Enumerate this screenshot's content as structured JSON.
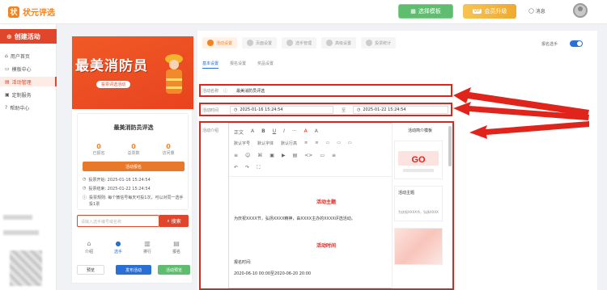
{
  "header": {
    "logo_text": "状元评选",
    "template_btn": "选择模板",
    "vip_badge": "VIP",
    "vip_btn": "会员升级",
    "msg_label": "消息",
    "accent": "#f5821f"
  },
  "sidebar": {
    "create_btn": "创建活动",
    "items": [
      {
        "label": "用户首页",
        "icon": "home-icon"
      },
      {
        "label": "模板中心",
        "icon": "folder-icon"
      },
      {
        "label": "活动管理",
        "icon": "list-icon",
        "active": true
      },
      {
        "label": "定制服务",
        "icon": "service-icon"
      },
      {
        "label": "帮助中心",
        "icon": "help-icon"
      }
    ]
  },
  "preview": {
    "poster_title": "最美消防员",
    "poster_pill": "投票评选活动",
    "card_title": "最美消防员评选",
    "stats": [
      {
        "n": "0",
        "l": "已报名"
      },
      {
        "n": "0",
        "l": "总票数"
      },
      {
        "n": "0",
        "l": "访问量"
      }
    ],
    "apply_btn": "活动报名",
    "info": [
      "投票开始: 2025-01-16 15:24:54",
      "投票结束: 2025-01-22 15:24:54",
      "投票规则: 每个微信号每天可投1次，可以对同一选手投1票"
    ],
    "search_placeholder": "请输入选手编号或名称",
    "search_btn": "搜索",
    "nav": [
      "介绍",
      "选手",
      "排行",
      "报名"
    ],
    "btn_preview": "预览",
    "btn_publish": "发布活动",
    "btn_publish_preview": "活动预览"
  },
  "main": {
    "steps": [
      "活动设置",
      "页面设置",
      "选手管理",
      "高级设置",
      "投票统计"
    ],
    "toggle_label": "报名选手",
    "subtabs": [
      "基本设置",
      "报名设置",
      "奖品设置"
    ],
    "name_label": "活动名称",
    "name_value": "最美消防员评选",
    "time_label": "活动时间",
    "time_start": "2025-01-16 15:24:54",
    "time_sep": "至",
    "time_end": "2025-01-22 15:24:54",
    "intro_label": "活动介绍",
    "toolbar_row1": [
      "正文",
      "A",
      "B",
      "U",
      "I",
      "···",
      "A",
      "A"
    ],
    "toolbar_row2": [
      "默认字号",
      "默认字体",
      "默认行高",
      "≡",
      "≡",
      "▭",
      "▭",
      "▭"
    ],
    "toolbar_row3": [
      "≡",
      "☺",
      "⌘",
      "▣",
      "▶",
      "▤",
      "<>",
      "▭",
      "≡"
    ],
    "toolbar_row4": [
      "↶",
      "↷",
      "⛶"
    ],
    "editor": {
      "h1": "活动主题",
      "p1": "为庆祝XXXX节，弘扬XXXX精神，由XXXX主办的XXXX评选活动。",
      "h2": "活动时间",
      "p2": "报名时间:",
      "p3": "2020-06-10 00:00至2020-06-20 20:00"
    },
    "template_panel": {
      "title": "活动简介模板",
      "card2_title": "活动主题",
      "card2_text": "为庆祝XXXX节，弘扬XXXX精神，由XXXX"
    }
  }
}
